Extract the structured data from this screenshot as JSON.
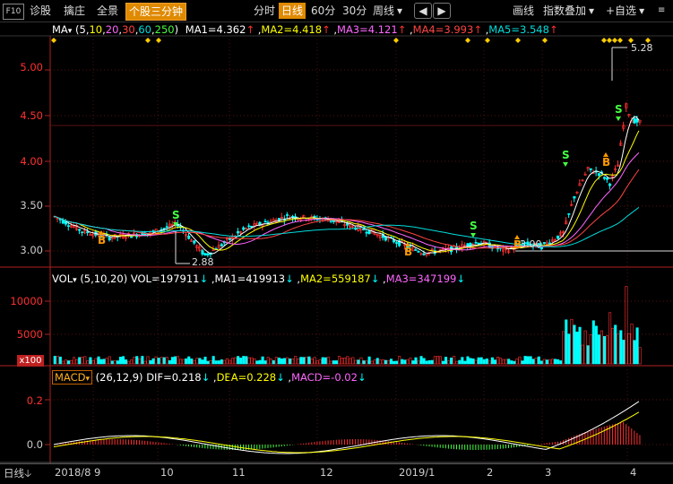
{
  "toolbar": {
    "f10": "F10",
    "left_items": [
      "诊股",
      "擒庄",
      "全景"
    ],
    "active_button": "个股三分钟",
    "periods": [
      "分时",
      "日线",
      "60分",
      "30分",
      "周线"
    ],
    "period_selected": "日线",
    "period_more": "▾",
    "left_arrow": "◀",
    "right_arrow": "▶",
    "draw": "画线",
    "index_overlay": "指数叠加",
    "watchlist": "+自选"
  },
  "main": {
    "ma_label": "MA",
    "ma_params": [
      "5",
      "10",
      "20",
      "30",
      "60",
      "250"
    ],
    "ma_values": [
      {
        "label": "MA1=4.362",
        "color": "#ffffff"
      },
      {
        "label": "MA2=4.418",
        "color": "#ffff00"
      },
      {
        "label": "MA3=4.121",
        "color": "#ff66ff"
      },
      {
        "label": "MA4=3.993",
        "color": "#ff4444"
      },
      {
        "label": "MA5=3.548",
        "color": "#00dddd"
      }
    ],
    "y_ticks": [
      "5.00",
      "4.50",
      "4.00",
      "3.50",
      "3.00"
    ],
    "price_high": "5.28",
    "price_low": "2.88",
    "level_mark": "3.00",
    "signals_b": "B",
    "signals_s": "S"
  },
  "volume": {
    "label": "VOL",
    "params": "(5,10,20)",
    "items": [
      {
        "label": "VOL=197911",
        "color": "#ffffff"
      },
      {
        "label": "MA1=419913",
        "color": "#ffffff"
      },
      {
        "label": "MA2=559187",
        "color": "#ffff00"
      },
      {
        "label": "MA3=347199",
        "color": "#ff66ff"
      }
    ],
    "y_ticks": [
      "10000",
      "5000"
    ],
    "unit": "x100"
  },
  "macd": {
    "label": "MACD",
    "params": "(26,12,9)",
    "items": [
      {
        "label": "DIF=0.218",
        "color": "#ffffff"
      },
      {
        "label": "DEA=0.228",
        "color": "#ffff00"
      },
      {
        "label": "MACD=-0.02",
        "color": "#ff66ff"
      }
    ],
    "y_ticks": [
      "0.2",
      "0.0"
    ]
  },
  "bottom": {
    "period_label": "日线",
    "x_labels": [
      "2018/8",
      "9",
      "10",
      "11",
      "12",
      "2019/1",
      "2",
      "3",
      "4"
    ]
  },
  "colors": {
    "up": "#ff3030",
    "down": "#00ffff",
    "axis_red": "#b02020",
    "accent": "#e08a00"
  }
}
